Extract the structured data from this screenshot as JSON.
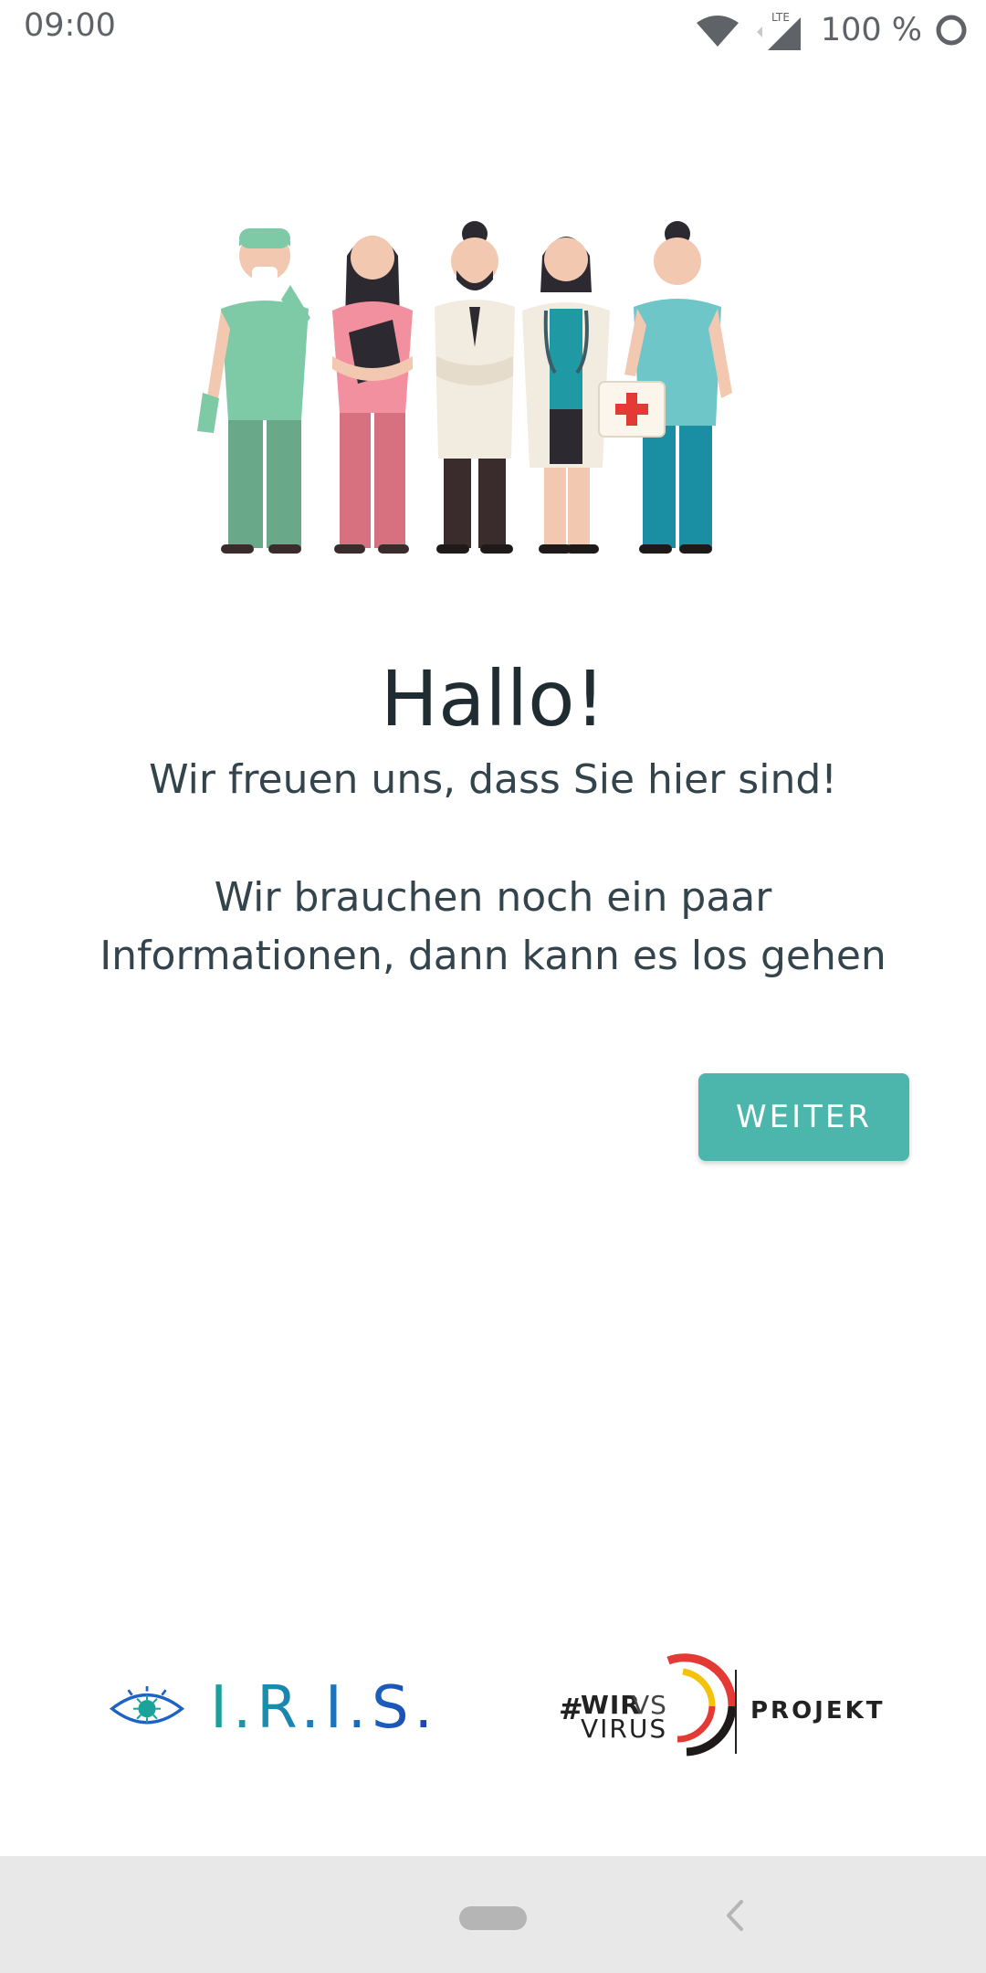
{
  "status_bar": {
    "time": "09:00",
    "battery": "100 %",
    "network_label": "LTE",
    "icons": [
      "wifi-icon",
      "cell-signal-icon",
      "battery-icon"
    ]
  },
  "welcome": {
    "title": "Hallo!",
    "subtitle": "Wir freuen uns, dass Sie hier sind!",
    "info": "Wir brauchen noch ein paar Informationen, dann kann es los gehen"
  },
  "actions": {
    "next_label": "WEITER"
  },
  "footer": {
    "iris_logo_text": "I.R.I.S.",
    "wirvsvirus": {
      "hash": "#",
      "wir": "WIR",
      "vs": "VS",
      "virus": "VIRUS",
      "projekt": "PROJEKT"
    }
  },
  "nav_bar": {
    "icons": [
      "home-pill-icon",
      "back-chevron-icon"
    ]
  },
  "colors": {
    "accent": "#4db6ac",
    "heading": "#1f2d33",
    "body_text": "#34444c",
    "nav_background": "#e8e8e8"
  }
}
